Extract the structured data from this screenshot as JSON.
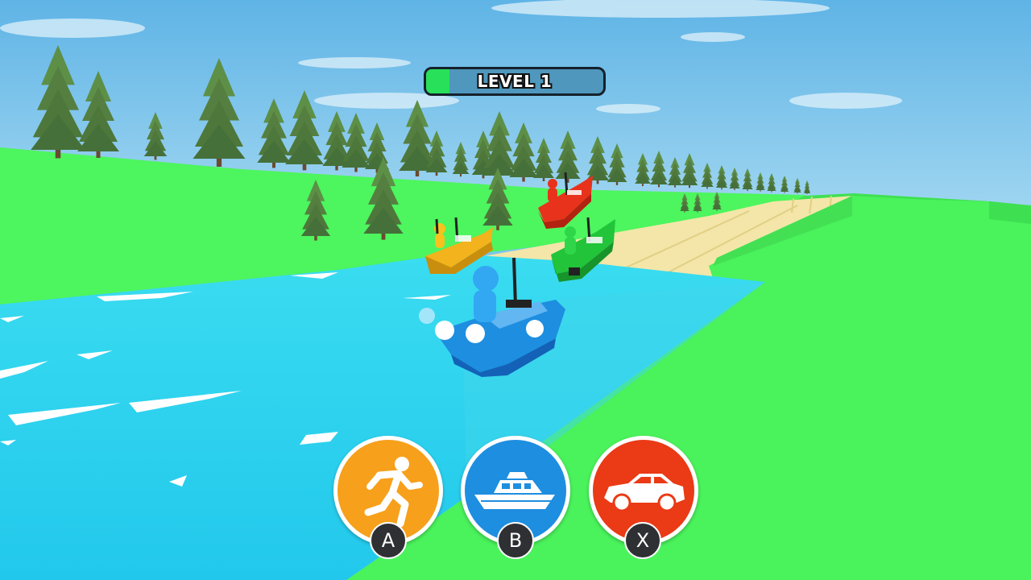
{
  "hud": {
    "level_label": "LEVEL 1",
    "progress": 0.13
  },
  "controls": [
    {
      "mode": "run",
      "icon": "running-person-icon",
      "key": "A",
      "color": "#f6a01b"
    },
    {
      "mode": "boat",
      "icon": "boat-icon",
      "key": "B",
      "color": "#1e8ee0"
    },
    {
      "mode": "car",
      "icon": "car-icon",
      "key": "X",
      "color": "#ea3a16"
    }
  ],
  "racers": [
    {
      "player": "player",
      "color": "#1e8ee0"
    },
    {
      "player": "opponent",
      "color": "#f2b31c"
    },
    {
      "player": "opponent",
      "color": "#e8321c"
    },
    {
      "player": "opponent",
      "color": "#22c43a"
    }
  ],
  "colors": {
    "sky": "#7cc6ec",
    "grass": "#4df55e",
    "water": "#2bd3ee",
    "sand": "#f3e6a8"
  }
}
